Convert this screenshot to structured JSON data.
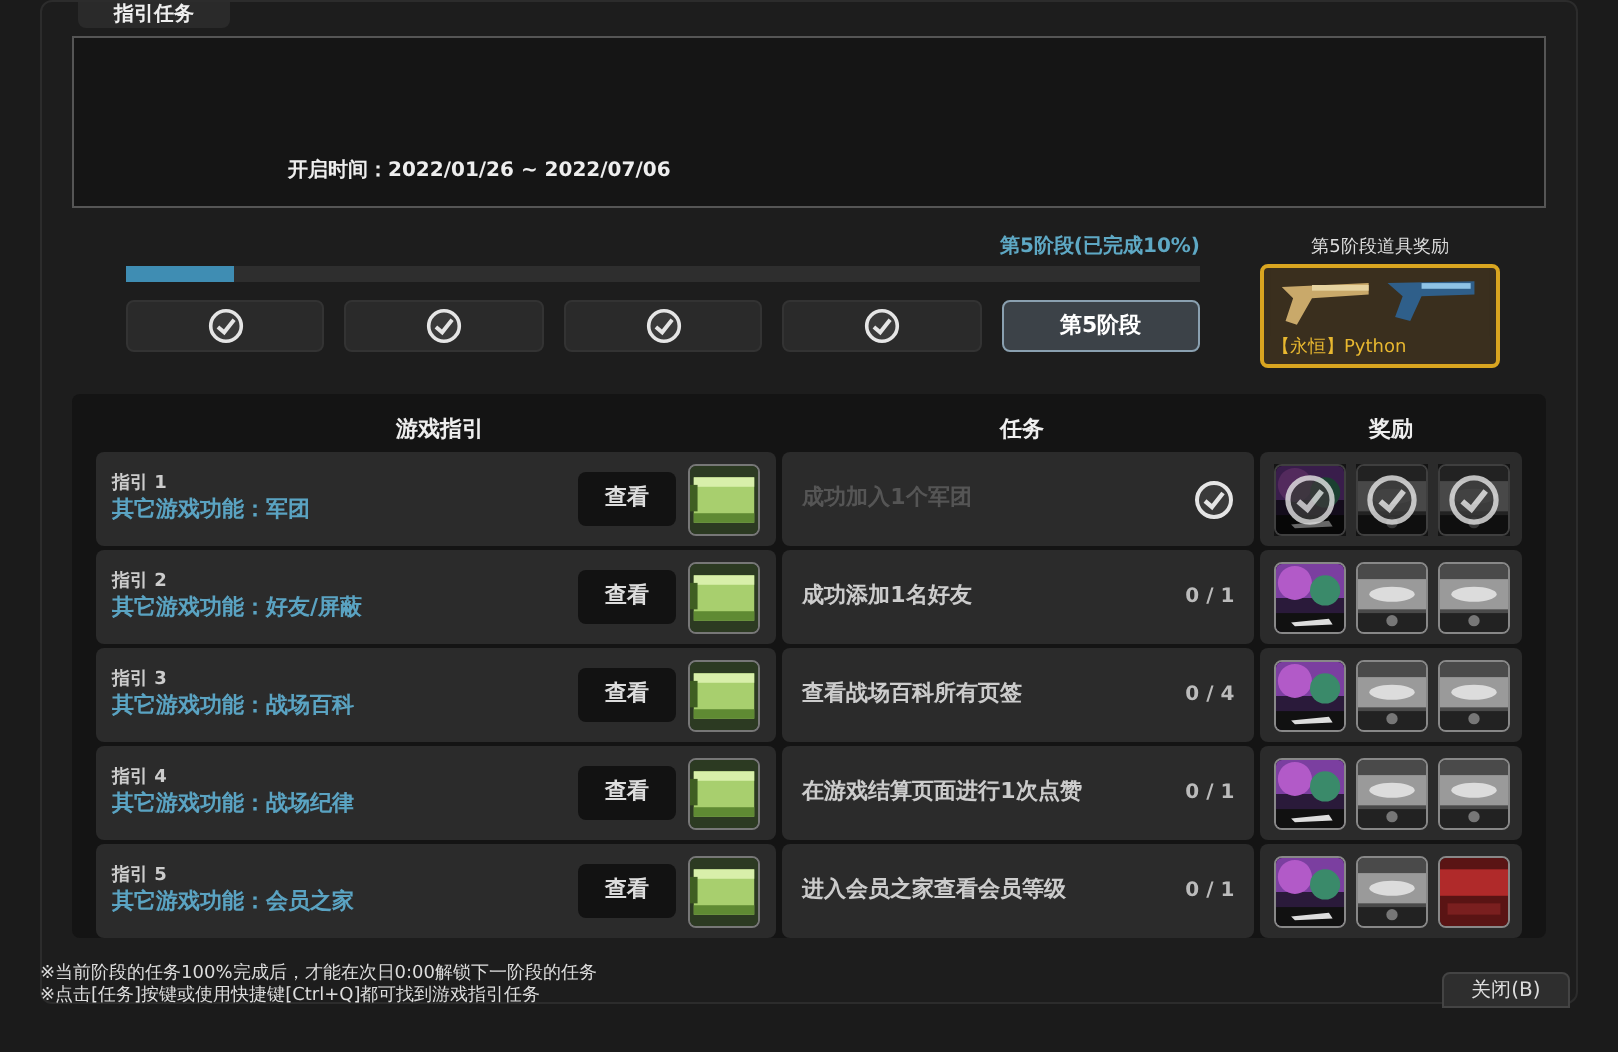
{
  "window": {
    "title": "指引任务"
  },
  "info": {
    "open_time": "开启时间：2022/01/26 ~ 2022/07/06"
  },
  "progress": {
    "label": "第5阶段(已完成10%)",
    "level": 0.1
  },
  "stages": [
    {
      "completed": true,
      "selected": false
    },
    {
      "completed": true,
      "selected": false
    },
    {
      "completed": true,
      "selected": false
    },
    {
      "completed": true,
      "selected": false
    },
    {
      "label": "第5阶段",
      "completed": false,
      "selected": true
    }
  ],
  "stage_reward": {
    "title": "第5阶段道具奖励",
    "item_name": "【永恒】Python"
  },
  "table": {
    "columns": [
      "游戏指引",
      "任务",
      "奖励"
    ],
    "rows": [
      {
        "guide_no": "指引 1",
        "guide_title": "其它游戏功能：军团",
        "view_button": "查看",
        "task": "成功加入1个军团",
        "completed": true,
        "rewards": [
          {
            "kind": "purple",
            "claimed": true
          },
          {
            "kind": "silver",
            "claimed": true
          },
          {
            "kind": "silver",
            "claimed": true
          }
        ]
      },
      {
        "guide_no": "指引 2",
        "guide_title": "其它游戏功能：好友/屏蔽",
        "view_button": "查看",
        "task": "成功添加1名好友",
        "completed": false,
        "count": "0 / 1",
        "rewards": [
          {
            "kind": "purple",
            "claimed": false
          },
          {
            "kind": "silver",
            "claimed": false
          },
          {
            "kind": "silver",
            "claimed": false
          }
        ]
      },
      {
        "guide_no": "指引 3",
        "guide_title": "其它游戏功能：战场百科",
        "view_button": "查看",
        "task": "查看战场百科所有页签",
        "completed": false,
        "count": "0 / 4",
        "rewards": [
          {
            "kind": "purple",
            "claimed": false
          },
          {
            "kind": "silver",
            "claimed": false
          },
          {
            "kind": "silver",
            "claimed": false
          }
        ]
      },
      {
        "guide_no": "指引 4",
        "guide_title": "其它游戏功能：战场纪律",
        "view_button": "查看",
        "task": "在游戏结算页面进行1次点赞",
        "completed": false,
        "count": "0 / 1",
        "rewards": [
          {
            "kind": "purple",
            "claimed": false
          },
          {
            "kind": "silver",
            "claimed": false
          },
          {
            "kind": "silver",
            "claimed": false
          }
        ]
      },
      {
        "guide_no": "指引 5",
        "guide_title": "其它游戏功能：会员之家",
        "view_button": "查看",
        "task": "进入会员之家查看会员等级",
        "completed": false,
        "count": "0 / 1",
        "rewards": [
          {
            "kind": "purple",
            "claimed": false
          },
          {
            "kind": "silver",
            "claimed": false
          },
          {
            "kind": "ruby",
            "claimed": false
          }
        ]
      }
    ]
  },
  "notes": [
    "※当前阶段的任务100%完成后，才能在次日0:00解锁下一阶段的任务",
    "※点击[任务]按键或使用快捷键[Ctrl+Q]都可找到游戏指引任务"
  ],
  "close_button": "关闭(B)"
}
